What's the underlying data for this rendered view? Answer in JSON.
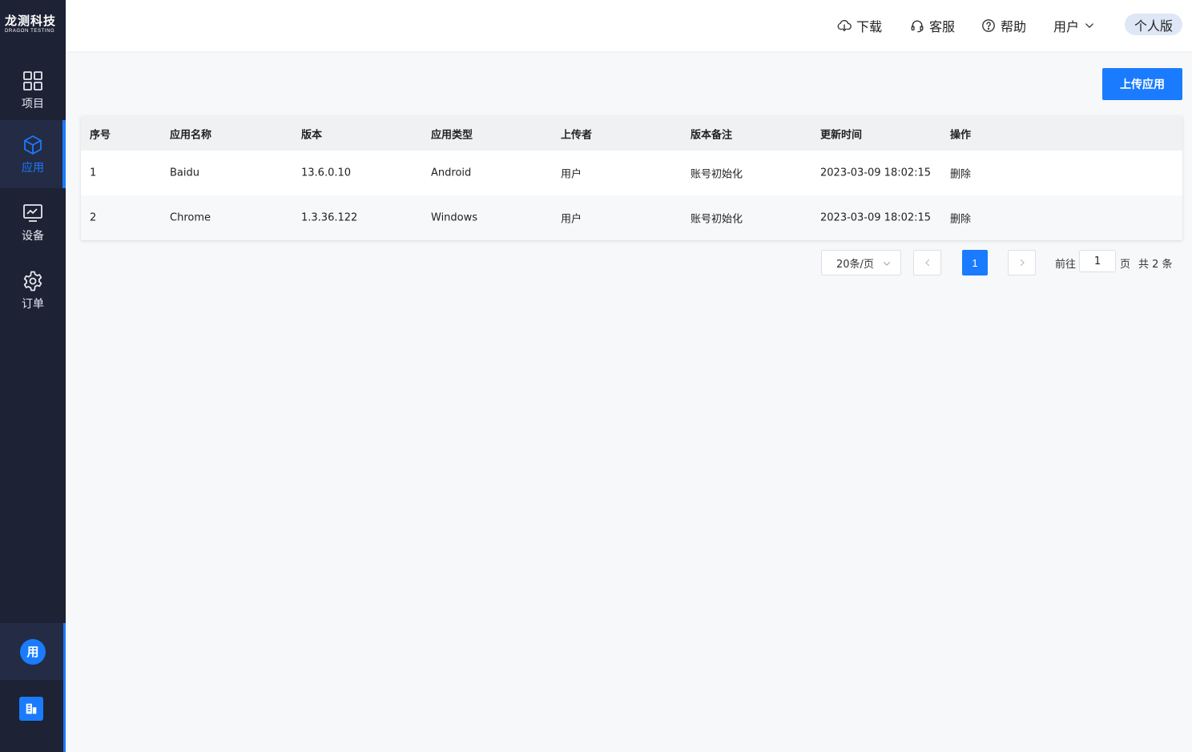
{
  "brand": {
    "name_cn": "龙测科技",
    "name_en": "DRAGON TESTING"
  },
  "sidebar": {
    "items": [
      {
        "label": "项目",
        "icon": "grid-icon"
      },
      {
        "label": "应用",
        "icon": "cube-icon",
        "active": true
      },
      {
        "label": "设备",
        "icon": "monitor-icon"
      },
      {
        "label": "订单",
        "icon": "gear-icon"
      }
    ],
    "avatar_text": "用"
  },
  "header": {
    "download": "下载",
    "service": "客服",
    "help": "帮助",
    "user": "用户",
    "edition": "个人版"
  },
  "actions": {
    "upload": "上传应用"
  },
  "table": {
    "columns": [
      "序号",
      "应用名称",
      "版本",
      "应用类型",
      "上传者",
      "版本备注",
      "更新时间",
      "操作"
    ],
    "rows": [
      [
        "1",
        "Baidu",
        "13.6.0.10",
        "Android",
        "用户",
        "账号初始化",
        "2023-03-09 18:02:15",
        "删除"
      ],
      [
        "2",
        "Chrome",
        "1.3.36.122",
        "Windows",
        "用户",
        "账号初始化",
        "2023-03-09 18:02:15",
        "删除"
      ]
    ]
  },
  "pagination": {
    "page_size": "20条/页",
    "current_page": "1",
    "goto_prefix": "前往",
    "goto_value": "1",
    "goto_suffix": "页",
    "total": "共 2 条"
  },
  "colors": {
    "accent": "#1a7bff",
    "sidebar_bg": "#1d2235"
  }
}
